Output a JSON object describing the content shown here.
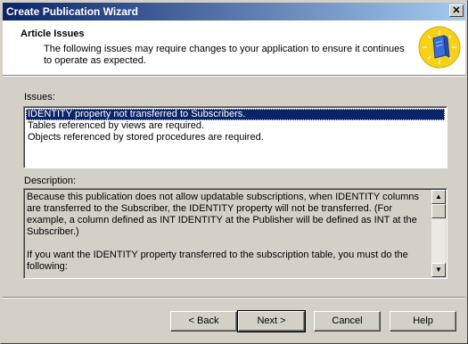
{
  "window": {
    "title": "Create Publication Wizard",
    "close_glyph": "✕"
  },
  "header": {
    "title": "Article Issues",
    "description": "The following issues may require changes to your application to ensure it continues to operate as expected.",
    "icon": "wizard-book-icon"
  },
  "issues": {
    "label": "Issues:",
    "items": [
      {
        "label": "IDENTITY property not transferred to Subscribers.",
        "selected": true
      },
      {
        "label": "Tables referenced by views are required.",
        "selected": false
      },
      {
        "label": "Objects referenced by stored procedures are required.",
        "selected": false
      }
    ]
  },
  "description": {
    "label": "Description:",
    "paragraphs": [
      "Because this publication does not allow updatable subscriptions, when IDENTITY columns are transferred to the Subscriber, the IDENTITY property will not be transferred. (For example, a column defined as INT IDENTITY at the Publisher will be defined as INT at the Subscriber.)",
      "If you want the IDENTITY property transferred to the subscription table, you must do the following:"
    ]
  },
  "buttons": {
    "back": "< Back",
    "next": "Next >",
    "cancel": "Cancel",
    "help": "Help"
  },
  "colors": {
    "title_bar_start": "#0a246a",
    "title_bar_end": "#a6caf0",
    "selection": "#0a246a",
    "dialog_face": "#d4d0c8"
  }
}
